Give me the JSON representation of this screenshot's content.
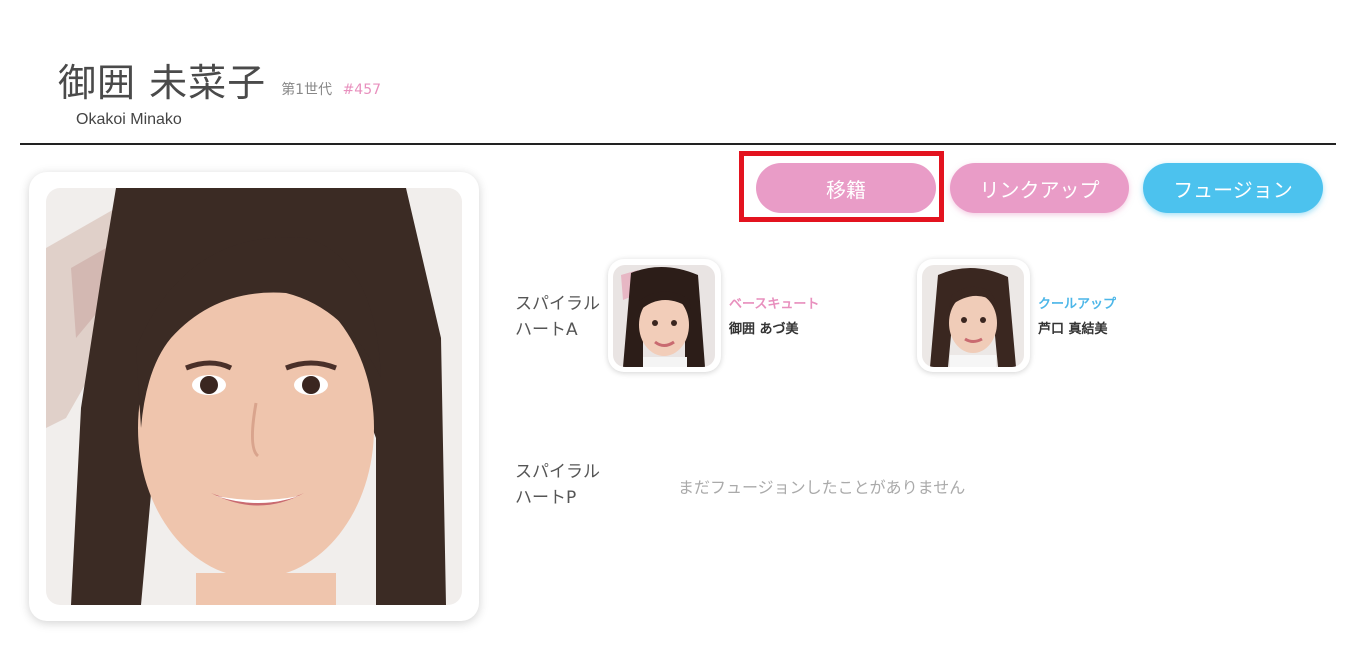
{
  "profile": {
    "name_jp": "御囲 未菜子",
    "generation": "第1世代",
    "number": "#457",
    "name_en": "Okakoi Minako"
  },
  "actions": {
    "transfer_label": "移籍",
    "linkup_label": "リンクアップ",
    "fusion_label": "フュージョン"
  },
  "spiral_a": {
    "label": "スパイラル\nハートA",
    "partners": [
      {
        "type": "ベースキュート",
        "name": "御囲 あづ美"
      },
      {
        "type": "クールアップ",
        "name": "芦口 真結美"
      }
    ]
  },
  "spiral_p": {
    "label": "スパイラル\nハートP",
    "empty_message": "まだフュージョンしたことがありません"
  },
  "colors": {
    "pink": "#e99cc7",
    "blue": "#4cc2ee",
    "highlight": "#e3131f"
  }
}
